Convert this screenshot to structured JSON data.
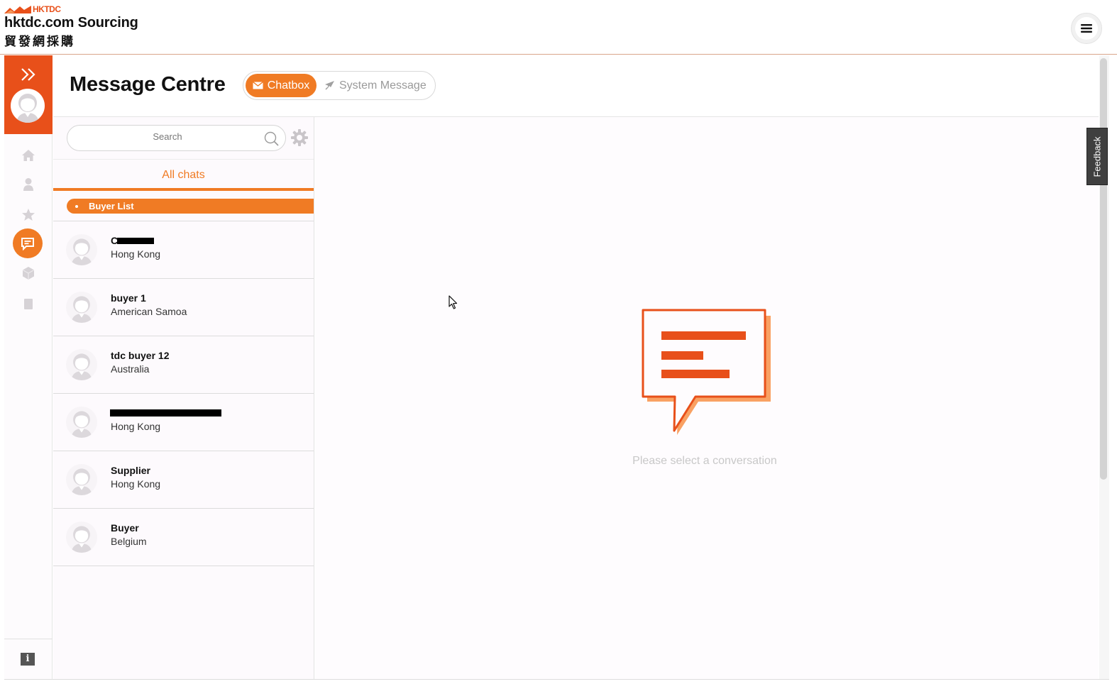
{
  "header": {
    "brand_small": "HKTDC",
    "brand_name": "hktdc.com Sourcing",
    "brand_chinese": "貿發網採購",
    "menu_icon": "hamburger-icon"
  },
  "rail": {
    "expand_icon": "double-chevron-right-icon",
    "items": [
      "home-icon",
      "user-icon",
      "star-icon",
      "chat-icon",
      "box-icon",
      "document-icon"
    ],
    "active_item": "chat-icon",
    "info_label": "i"
  },
  "page": {
    "title": "Message Centre",
    "tabs": [
      {
        "label": "Chatbox",
        "icon": "envelope-icon",
        "active": true
      },
      {
        "label": "System Message",
        "icon": "rocket-icon",
        "active": false
      }
    ]
  },
  "chat_list": {
    "search_placeholder": "Search",
    "filter_label": "All chats",
    "group_label": "Buyer List",
    "rows": [
      {
        "name": "C",
        "location": "Hong Kong",
        "redacted": true
      },
      {
        "name": "buyer 1",
        "location": "American Samoa",
        "redacted": false
      },
      {
        "name": "tdc buyer 12",
        "location": "Australia",
        "redacted": false
      },
      {
        "name": "",
        "location": "Hong Kong",
        "redacted": true
      },
      {
        "name": "Supplier",
        "location": "Hong Kong",
        "redacted": false
      },
      {
        "name": "Buyer",
        "location": "Belgium",
        "redacted": false
      }
    ]
  },
  "main": {
    "empty_text": "Please select a conversation"
  },
  "feedback_label": "Feedback",
  "colors": {
    "accent": "#f07b24",
    "brand": "#e8501a"
  }
}
